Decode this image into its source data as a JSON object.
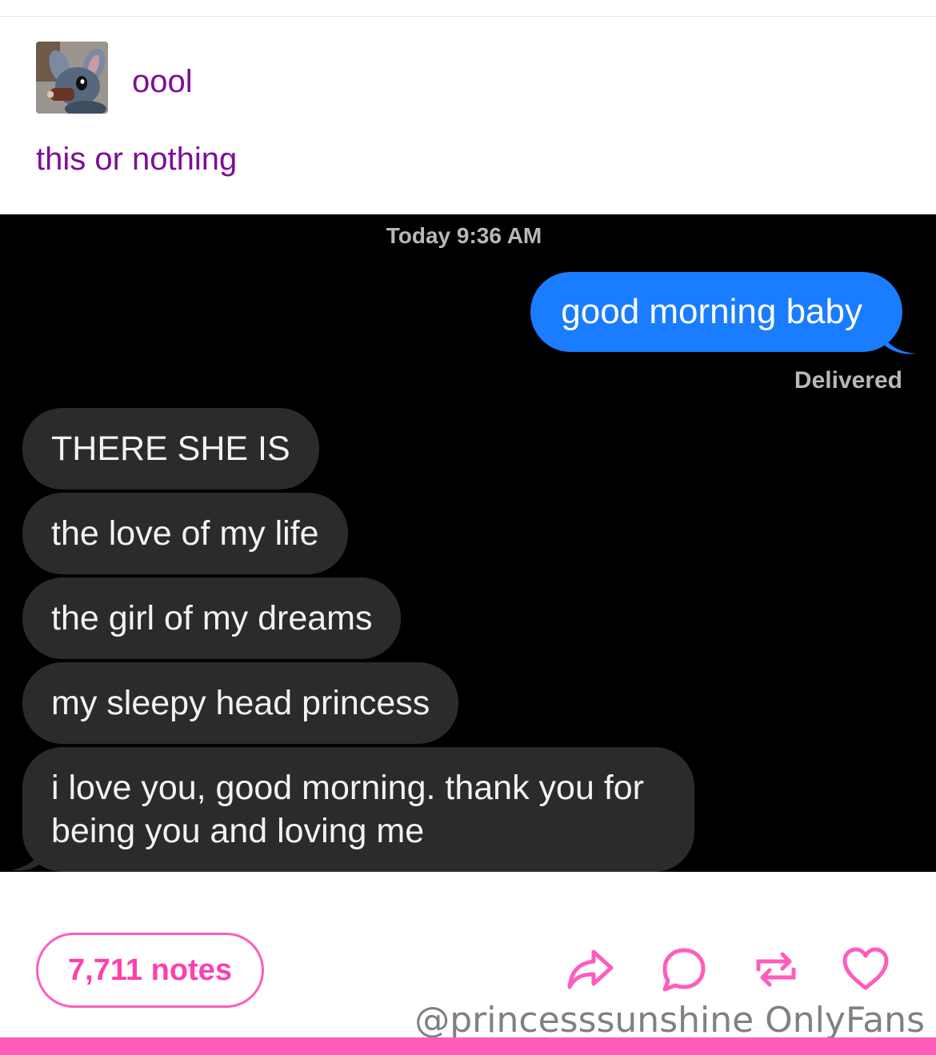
{
  "post": {
    "username": "oool",
    "caption": "this or nothing"
  },
  "chat": {
    "timestamp": "Today 9:36 AM",
    "sent": "good morning baby",
    "status": "Delivered",
    "received": [
      "THERE SHE IS",
      "the love of my life",
      "the girl of my dreams",
      "my sleepy head princess",
      "i love you, good morning. thank you for being you and loving me"
    ]
  },
  "footer": {
    "notes": "7,711 notes",
    "watermark": "@princesssunshine OnlyFans"
  },
  "icons": {
    "share": "share-arrow-icon",
    "reply": "speech-bubble-icon",
    "reblog": "reblog-icon",
    "like": "heart-icon"
  },
  "colors": {
    "accent_purple": "#7d0e97",
    "accent_pink": "#ff3fae",
    "imessage_blue": "#1a7cff",
    "received_bubble": "#2b2b2d"
  }
}
